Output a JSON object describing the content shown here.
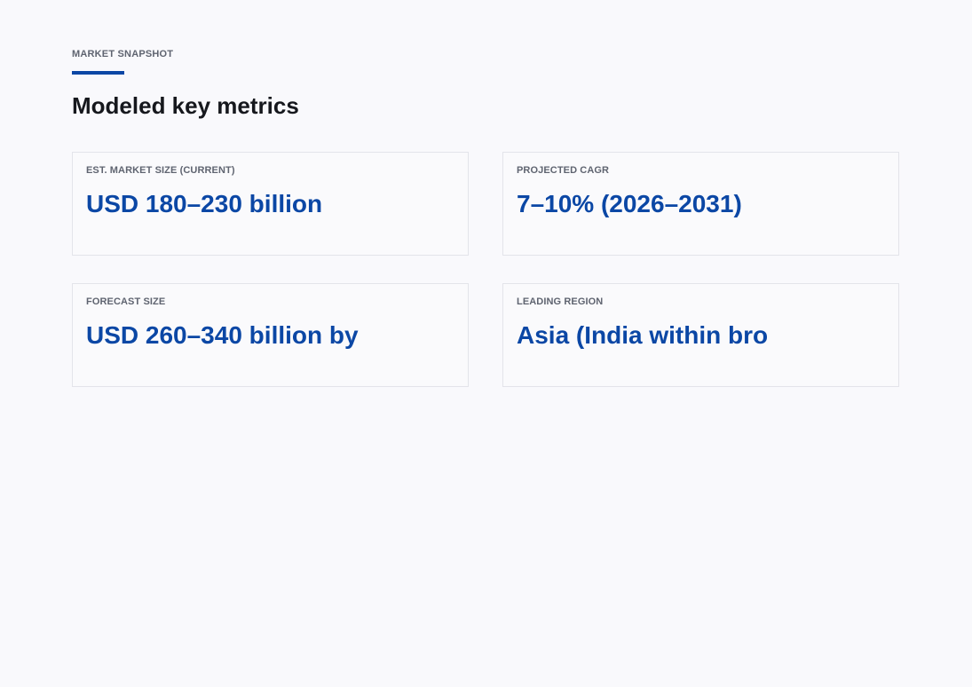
{
  "section": {
    "eyebrow": "MARKET SNAPSHOT",
    "title": "Modeled key metrics",
    "accent_color": "#0b47a5"
  },
  "metrics": [
    {
      "label": "EST. MARKET SIZE (CURRENT)",
      "value": "USD 180–230 billion"
    },
    {
      "label": "PROJECTED CAGR",
      "value": "7–10% (2026–2031)"
    },
    {
      "label": "FORECAST SIZE",
      "value": "USD 260–340 billion by"
    },
    {
      "label": "LEADING REGION",
      "value": "Asia (India within bro"
    }
  ]
}
